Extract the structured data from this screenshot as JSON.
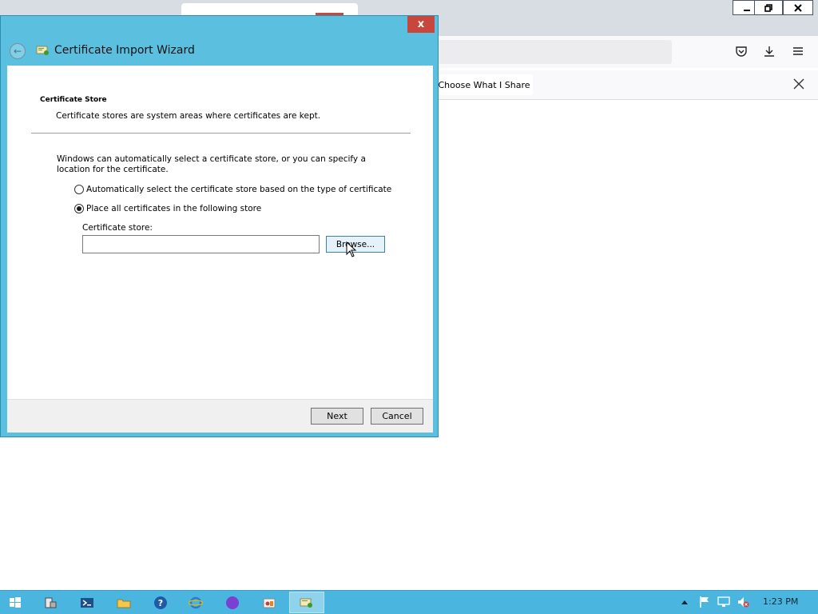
{
  "browser": {
    "tab_title": "",
    "notification": {
      "share_button_label": "Choose What I Share",
      "close_icon": "close-icon"
    },
    "toolbar_icons": [
      "pocket-icon",
      "download-icon",
      "menu-icon"
    ],
    "window_controls": [
      "minimize-icon",
      "restore-icon",
      "close-icon"
    ]
  },
  "dialog": {
    "title": "Certificate Import Wizard",
    "close_label": "x",
    "section_title": "Certificate Store",
    "section_desc": "Certificate stores are system areas where certificates are kept.",
    "intro_text": "Windows can automatically select a certificate store, or you can specify a location for the certificate.",
    "options": [
      {
        "label": "Automatically select the certificate store based on the type of certificate",
        "selected": false
      },
      {
        "label": "Place all certificates in the following store",
        "selected": true
      }
    ],
    "store_label": "Certificate store:",
    "store_value": "",
    "browse_label": "Browse...",
    "next_label": "Next",
    "cancel_label": "Cancel"
  },
  "taskbar": {
    "items": [
      "start-icon",
      "server-manager-icon",
      "powershell-icon",
      "file-explorer-icon",
      "help-icon",
      "internet-explorer-icon",
      "firefox-icon",
      "app-icon",
      "certificate-wizard-icon"
    ],
    "clock": "1:23 PM",
    "colors": {
      "taskbar": "#4ab6e0",
      "dialog_frame": "#5bc0e0"
    }
  }
}
